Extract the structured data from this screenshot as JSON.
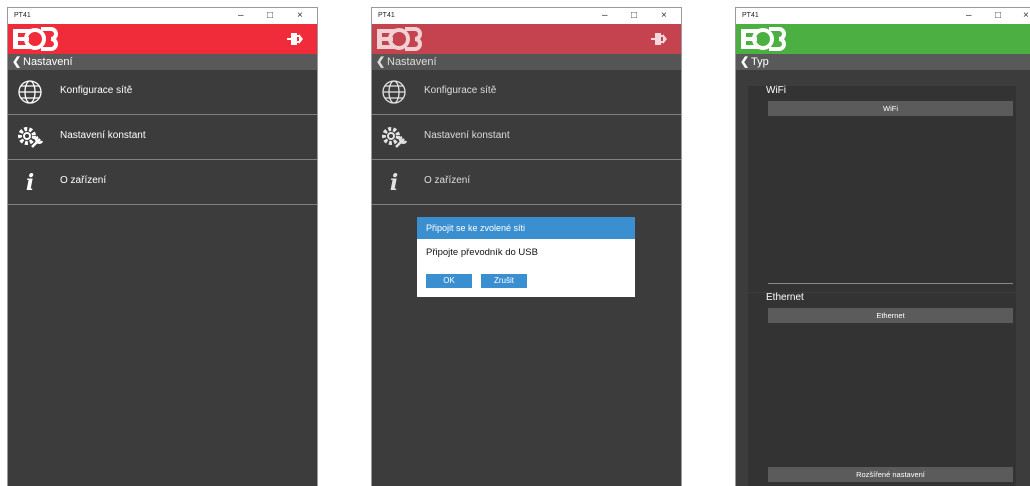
{
  "colors": {
    "brand_red": "#f12c3a",
    "brand_red_dim": "#c4434e",
    "brand_green": "#4caf41",
    "dialog_blue": "#3a8fd1",
    "app_bg": "#3c3c3c"
  },
  "window": {
    "title": "PT41",
    "minimize_glyph": "–",
    "maximize_glyph": "□",
    "close_glyph": "×"
  },
  "screen1": {
    "back_label": "Nastavení",
    "items": [
      {
        "label": "Konfigurace sítě",
        "icon": "globe-icon"
      },
      {
        "label": "Nastavení konstant",
        "icon": "gears-wrench-icon"
      },
      {
        "label": "O zařízení",
        "icon": "info-icon"
      }
    ]
  },
  "screen2": {
    "back_label": "Nastavení",
    "items": [
      {
        "label": "Konfigurace sítě",
        "icon": "globe-icon"
      },
      {
        "label": "Nastavení konstant",
        "icon": "gears-wrench-icon"
      },
      {
        "label": "O zařízení",
        "icon": "info-icon"
      }
    ],
    "dialog": {
      "title": "Připojit se ke zvolené síti",
      "message": "Připojte převodník do USB",
      "ok_label": "OK",
      "cancel_label": "Zrušit"
    }
  },
  "screen3": {
    "back_label": "Typ",
    "wifi": {
      "section_label": "WiFi",
      "button_label": "WiFi"
    },
    "ethernet": {
      "section_label": "Ethernet",
      "button_label": "Ethernet"
    },
    "advanced_label": "Rozšířené nastavení"
  }
}
